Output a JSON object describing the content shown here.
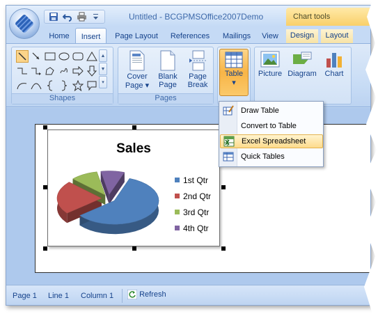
{
  "titlebar": {
    "title": "Untitled - BCGPMSOffice2007Demo",
    "contextual_group": "Chart tools"
  },
  "quick_access": {
    "items": [
      "save-icon",
      "undo-icon",
      "print-icon",
      "customize-qat-icon"
    ]
  },
  "tabs": [
    {
      "label": "Home"
    },
    {
      "label": "Insert"
    },
    {
      "label": "Page Layout"
    },
    {
      "label": "References"
    },
    {
      "label": "Mailings"
    },
    {
      "label": "View"
    },
    {
      "label": "Design"
    },
    {
      "label": "Layout"
    }
  ],
  "ribbon": {
    "shapes_label": "Shapes",
    "pages_label": "Pages",
    "cover_page": {
      "line1": "Cover",
      "line2": "Page"
    },
    "blank_page": {
      "line1": "Blank",
      "line2": "Page"
    },
    "page_break": {
      "line1": "Page",
      "line2": "Break"
    },
    "table": "Table",
    "picture": "Picture",
    "diagram": "Diagram",
    "chart": "Chart"
  },
  "table_menu": {
    "items": [
      {
        "label": "Draw Table",
        "icon": "draw-table-icon"
      },
      {
        "label": "Convert to Table",
        "icon": ""
      },
      {
        "label": "Excel Spreadsheet",
        "icon": "excel-spreadsheet-icon"
      },
      {
        "label": "Quick Tables",
        "icon": "quick-tables-icon"
      }
    ]
  },
  "chart_data": {
    "type": "pie",
    "title": "Sales",
    "categories": [
      "1st Qtr",
      "2nd Qtr",
      "3rd Qtr",
      "4th Qtr"
    ],
    "values": [
      8.2,
      3.2,
      1.4,
      1.2
    ],
    "colors": [
      "#4f81bd",
      "#c0504d",
      "#9bbb59",
      "#8064a2"
    ]
  },
  "statusbar": {
    "page": "Page 1",
    "line": "Line 1",
    "column": "Column 1",
    "refresh": "Refresh"
  }
}
